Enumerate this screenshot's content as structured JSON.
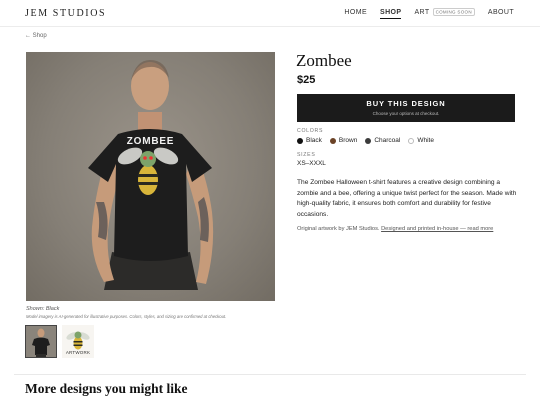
{
  "header": {
    "logo": "JEM STUDIOS",
    "nav": [
      {
        "label": "HOME"
      },
      {
        "label": "SHOP"
      },
      {
        "label": "ART",
        "badge": "COMING SOON"
      },
      {
        "label": "ABOUT"
      }
    ],
    "active": "SHOP"
  },
  "breadcrumb": "← Shop",
  "gallery": {
    "shirt_text": "ZOMBEE",
    "caption": "Shown: Black",
    "disclaimer": "Model imagery is AI-generated for illustrative purposes. Colors, styles, and sizing are confirmed at checkout.",
    "thumb2_label": "ARTWORK"
  },
  "product": {
    "title": "Zombee",
    "price": "$25",
    "buy_label": "BUY THIS DESIGN",
    "buy_sub": "Choose your options at checkout.",
    "colors_label": "COLORS",
    "colors": [
      {
        "name": "Black",
        "hex": "#111111"
      },
      {
        "name": "Brown",
        "hex": "#6b4226"
      },
      {
        "name": "Charcoal",
        "hex": "#3b3b3b"
      },
      {
        "name": "White",
        "hex": "#ffffff"
      }
    ],
    "sizes_label": "SIZES",
    "sizes": "XS–XXXL",
    "description": "The Zombee Halloween t-shirt features a creative design combining a zombie and a bee, offering a unique twist perfect for the season. Made with high-quality fabric, it ensures both comfort and durability for festive occasions.",
    "origin_text": "Original artwork by JEM Studios. ",
    "origin_link": "Designed and printed in-house — read more"
  },
  "more_title": "More designs you might like"
}
